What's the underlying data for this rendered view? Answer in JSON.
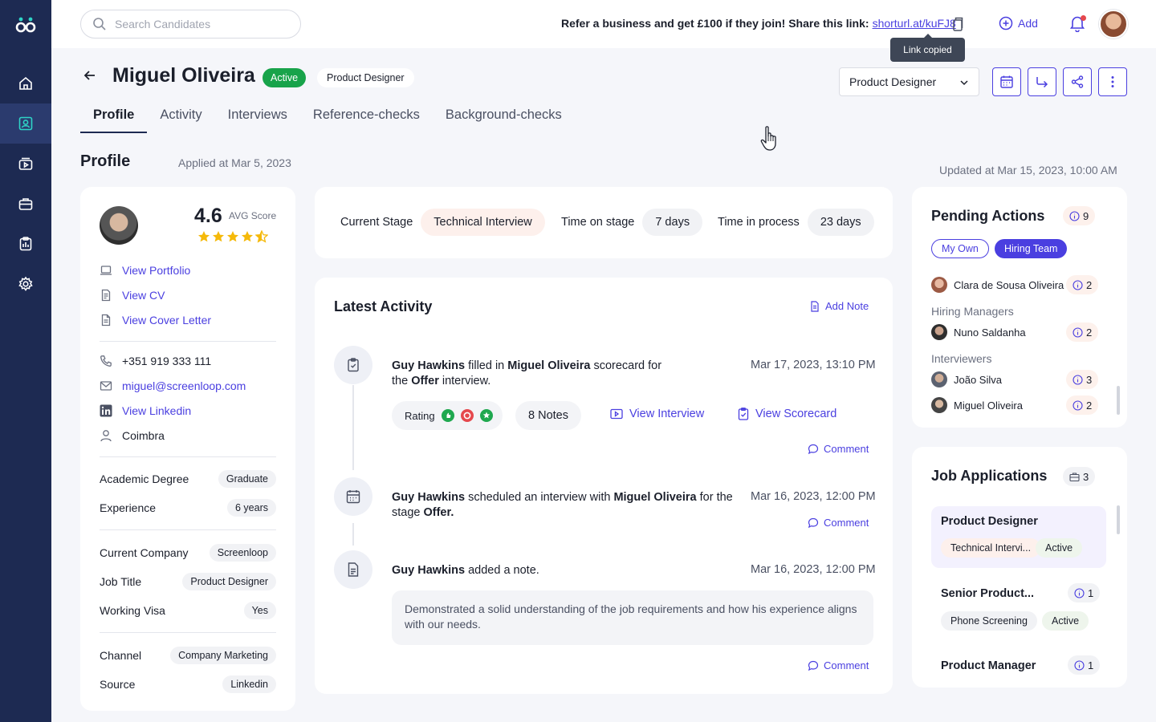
{
  "topbar": {
    "search_placeholder": "Search Candidates",
    "refer_text": "Refer a business and get £100 if they join! Share this link:",
    "refer_link": "shorturl.at/kuFJ8",
    "add_label": "Add",
    "tooltip": "Link copied"
  },
  "candidate": {
    "name": "Miguel Oliveira",
    "status": "Active",
    "role": "Product Designer",
    "role_select": "Product Designer"
  },
  "tabs": [
    "Profile",
    "Activity",
    "Interviews",
    "Reference-checks",
    "Background-checks"
  ],
  "profile": {
    "title": "Profile",
    "applied": "Applied at Mar 5, 2023",
    "updated": "Updated at Mar 15, 2023, 10:00 AM",
    "score": "4.6",
    "score_label": "AVG Score",
    "rating_stars": 4.5,
    "links": [
      "View Portfolio",
      "View CV",
      "View Cover Letter"
    ],
    "phone": "+351 919 333 111",
    "email": "miguel@screenloop.com",
    "linkedin": "View Linkedin",
    "location": "Coimbra",
    "fields": [
      {
        "label": "Academic Degree",
        "value": "Graduate"
      },
      {
        "label": "Experience",
        "value": "6 years"
      },
      {
        "label": "Current Company",
        "value": "Screenloop"
      },
      {
        "label": "Job Title",
        "value": "Product Designer"
      },
      {
        "label": "Working Visa",
        "value": "Yes"
      },
      {
        "label": "Channel",
        "value": "Company Marketing"
      },
      {
        "label": "Source",
        "value": "Linkedin"
      }
    ]
  },
  "stage": {
    "current_label": "Current Stage",
    "current_value": "Technical Interview",
    "time_stage_label": "Time on stage",
    "time_stage_value": "7 days",
    "time_process_label": "Time in process",
    "time_process_value": "23 days"
  },
  "activity": {
    "title": "Latest Activity",
    "add_note": "Add Note",
    "items": [
      {
        "actor": "Guy Hawkins",
        "t1": " filled in ",
        "subject": "Miguel Oliveira",
        "t2": " scorecard for the ",
        "obj": "Offer",
        "t3": " interview.",
        "date": "Mar 17, 2023, 13:10 PM",
        "rating_label": "Rating",
        "notes": "8 Notes",
        "view_interview": "View Interview",
        "view_scorecard": "View Scorecard",
        "comment": "Comment"
      },
      {
        "actor": "Guy Hawkins",
        "t1": " scheduled an interview with ",
        "subject": "Miguel Oliveira",
        "t2": " for the stage ",
        "obj": "Offer.",
        "date": "Mar 16, 2023, 12:00 PM",
        "comment": "Comment"
      },
      {
        "actor": "Guy Hawkins",
        "t1": " added a note.",
        "date": "Mar 16, 2023, 12:00 PM",
        "note": "Demonstrated a solid understanding of the job requirements and how his experience aligns with our needs.",
        "comment": "Comment"
      }
    ]
  },
  "pending": {
    "title": "Pending Actions",
    "count": "9",
    "toggle_own": "My Own",
    "toggle_team": "Hiring Team",
    "people": [
      {
        "name": "Clara de Sousa Oliveira",
        "count": "2"
      },
      {
        "name": "Nuno Saldanha",
        "count": "2"
      },
      {
        "name": "João Silva",
        "count": "3"
      },
      {
        "name": "Miguel Oliveira",
        "count": "2"
      }
    ],
    "group_managers": "Hiring Managers",
    "group_interviewers": "Interviewers"
  },
  "jobs": {
    "title": "Job Applications",
    "count": "3",
    "items": [
      {
        "name": "Product Designer",
        "stage": "Technical Intervi...",
        "status": "Active"
      },
      {
        "name": "Senior Product...",
        "count": "1",
        "stage": "Phone Screening",
        "status": "Active"
      },
      {
        "name": "Product Manager",
        "count": "1"
      }
    ]
  },
  "colors": {
    "accent": "#4A3FE0",
    "sidebar": "#1D2A52",
    "active_green": "#18A34A"
  }
}
